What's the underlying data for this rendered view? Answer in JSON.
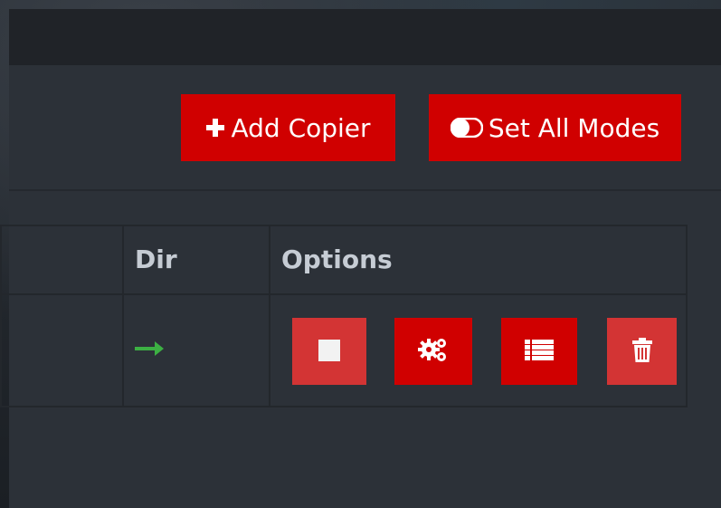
{
  "toolbar": {
    "add_copier": {
      "label": "Add Copier",
      "icon": "plus-icon"
    },
    "set_all_modes": {
      "label": "Set All Modes",
      "icon": "toggle-icon"
    }
  },
  "table": {
    "columns": [
      "",
      "Dir",
      "Options"
    ],
    "rows": [
      {
        "direction_icon": "arrow-right-icon",
        "direction_color": "#3cb043",
        "options": [
          "stop-icon",
          "cogs-icon",
          "list-icon",
          "trash-icon"
        ]
      }
    ]
  },
  "colors": {
    "accent_red": "#d00000",
    "muted_red": "#d33434",
    "panel_bg": "#2c3138",
    "header_text": "#c6ccd4"
  }
}
